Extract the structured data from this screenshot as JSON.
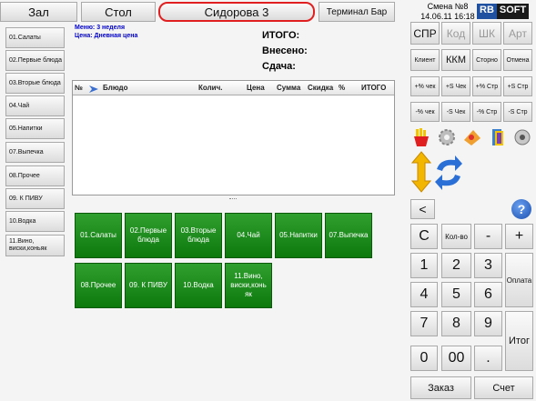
{
  "header": {
    "tab_hall": "Зал",
    "tab_table": "Стол",
    "tab_client": "Сидорова 3",
    "tab_terminal": "Терминал Бар",
    "shift": "Смена №8",
    "datetime": "14.06.11 16:18",
    "logo_left": "RB",
    "logo_right": "SOFT"
  },
  "sidebar": {
    "items": [
      {
        "label": "01.Салаты"
      },
      {
        "label": "02.Первые блюда"
      },
      {
        "label": "03.Вторые блюда"
      },
      {
        "label": "04.Чай"
      },
      {
        "label": "05.Напитки"
      },
      {
        "label": "07.Выпечка"
      },
      {
        "label": "08.Прочее"
      },
      {
        "label": "09. К ПИВУ"
      },
      {
        "label": "10.Водка"
      },
      {
        "label": "11.Вино, виски,коньяк"
      }
    ]
  },
  "order_info": {
    "menu": "Меню: 3 неделя",
    "price": "Цена: Дневная цена"
  },
  "totals": {
    "total": "ИТОГО:",
    "paid": "Внесено:",
    "change": "Сдача:"
  },
  "table": {
    "columns": [
      "№",
      "Блюдо",
      "Колич.",
      "Цена",
      "Сумма",
      "Скидка",
      "%",
      "ИТОГО"
    ],
    "rows": []
  },
  "categories": [
    {
      "label": "01.Салаты"
    },
    {
      "label": "02.Первые блюда"
    },
    {
      "label": "03.Вторые блюда"
    },
    {
      "label": "04.Чай"
    },
    {
      "label": "05.Напитки"
    },
    {
      "label": "07.Выпечка"
    },
    {
      "label": "08.Прочее"
    },
    {
      "label": "09. К ПИВУ"
    },
    {
      "label": "10.Водка"
    },
    {
      "label": "11.Вино, виски,конь як"
    }
  ],
  "right_panel": {
    "spr": "СПР",
    "code": "Код",
    "shk": "ШК",
    "art": "Арт",
    "client": "Клиент",
    "kkm": "ККМ",
    "storno": "Сторно",
    "cancel": "Отмена",
    "pct_check_plus": "+% чек",
    "s_check_plus": "+S Чек",
    "pct_line_plus": "+% Стр",
    "s_line_plus": "+S Стр",
    "pct_check_minus": "-% чек",
    "s_check_minus": "-S Чек",
    "pct_line_minus": "-% Стр",
    "s_line_minus": "-S Стр",
    "back": "<",
    "help": "?"
  },
  "numpad": {
    "clear": "C",
    "qty": "Кол-во",
    "minus": "-",
    "plus": "+",
    "k1": "1",
    "k2": "2",
    "k3": "3",
    "k4": "4",
    "k5": "5",
    "k6": "6",
    "k7": "7",
    "k8": "8",
    "k9": "9",
    "k0": "0",
    "k00": "00",
    "dot": ".",
    "payment": "Оплата",
    "total": "Итог",
    "order": "Заказ",
    "bill": "Счет"
  }
}
